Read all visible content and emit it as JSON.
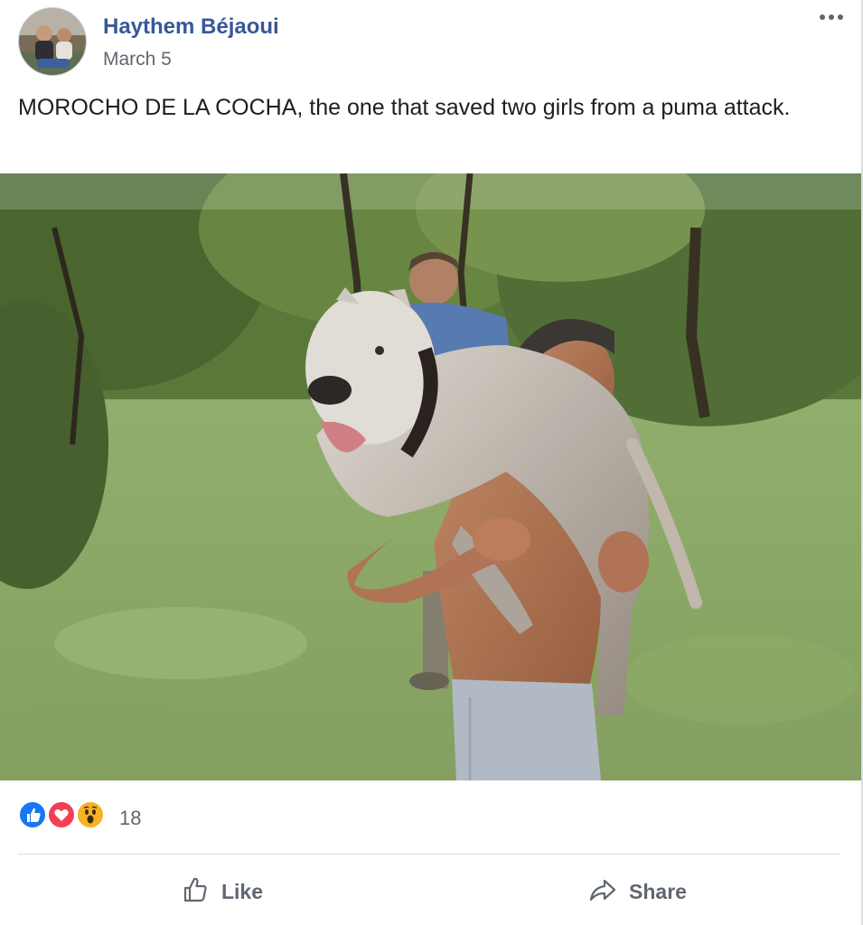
{
  "post": {
    "author": "Haythem Béjaoui",
    "date": "March 5",
    "text": "MOROCHO DE LA COCHA, the one that saved two girls from a puma attack.",
    "reactions": {
      "icons": [
        "like-icon",
        "love-icon",
        "wow-icon"
      ],
      "count": "18",
      "colors": {
        "like": "#1877f2",
        "love": "#f33e58",
        "wow": "#f7b125"
      }
    },
    "actions": {
      "like_label": "Like",
      "share_label": "Share"
    }
  },
  "colors": {
    "author_link": "#385898",
    "secondary_text": "#616770",
    "action_text": "#606770"
  }
}
